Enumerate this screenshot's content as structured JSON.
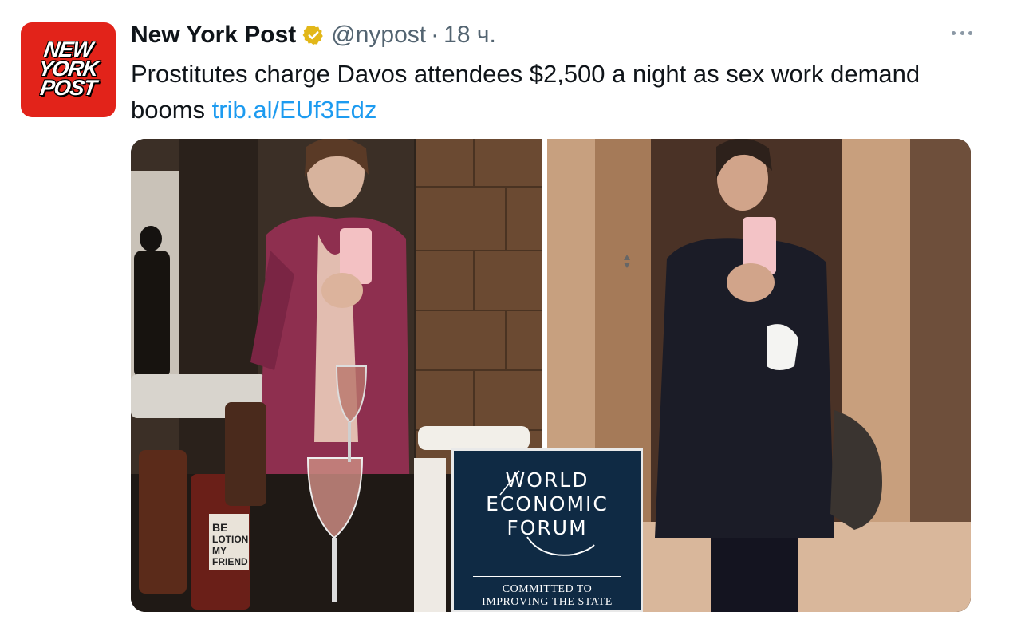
{
  "tweet": {
    "author_name": "New York Post",
    "verified_icon": "verified-badge-icon",
    "handle": "@nypost",
    "separator": "·",
    "time": "18 ч.",
    "text": "Prostitutes charge Davos attendees $2,500 a night as sex work demand booms ",
    "link": "trib.al/EUf3Edz"
  },
  "avatar": {
    "logo_lines": [
      "NEW",
      "YORK",
      "POST"
    ],
    "color": "#e2231a"
  },
  "media": {
    "lotion_label": [
      "BE",
      "LOTION",
      "MY",
      "FRIEND"
    ],
    "wef_logo": {
      "lines": [
        "WORLD",
        "ECONOMIC",
        "FORUM"
      ],
      "tagline": [
        "COMMITTED TO",
        "IMPROVING THE STATE"
      ],
      "background": "#0f2a44"
    }
  },
  "colors": {
    "link": "#1d9bf0",
    "secondary_text": "#536471",
    "verified": "#e2b719"
  }
}
